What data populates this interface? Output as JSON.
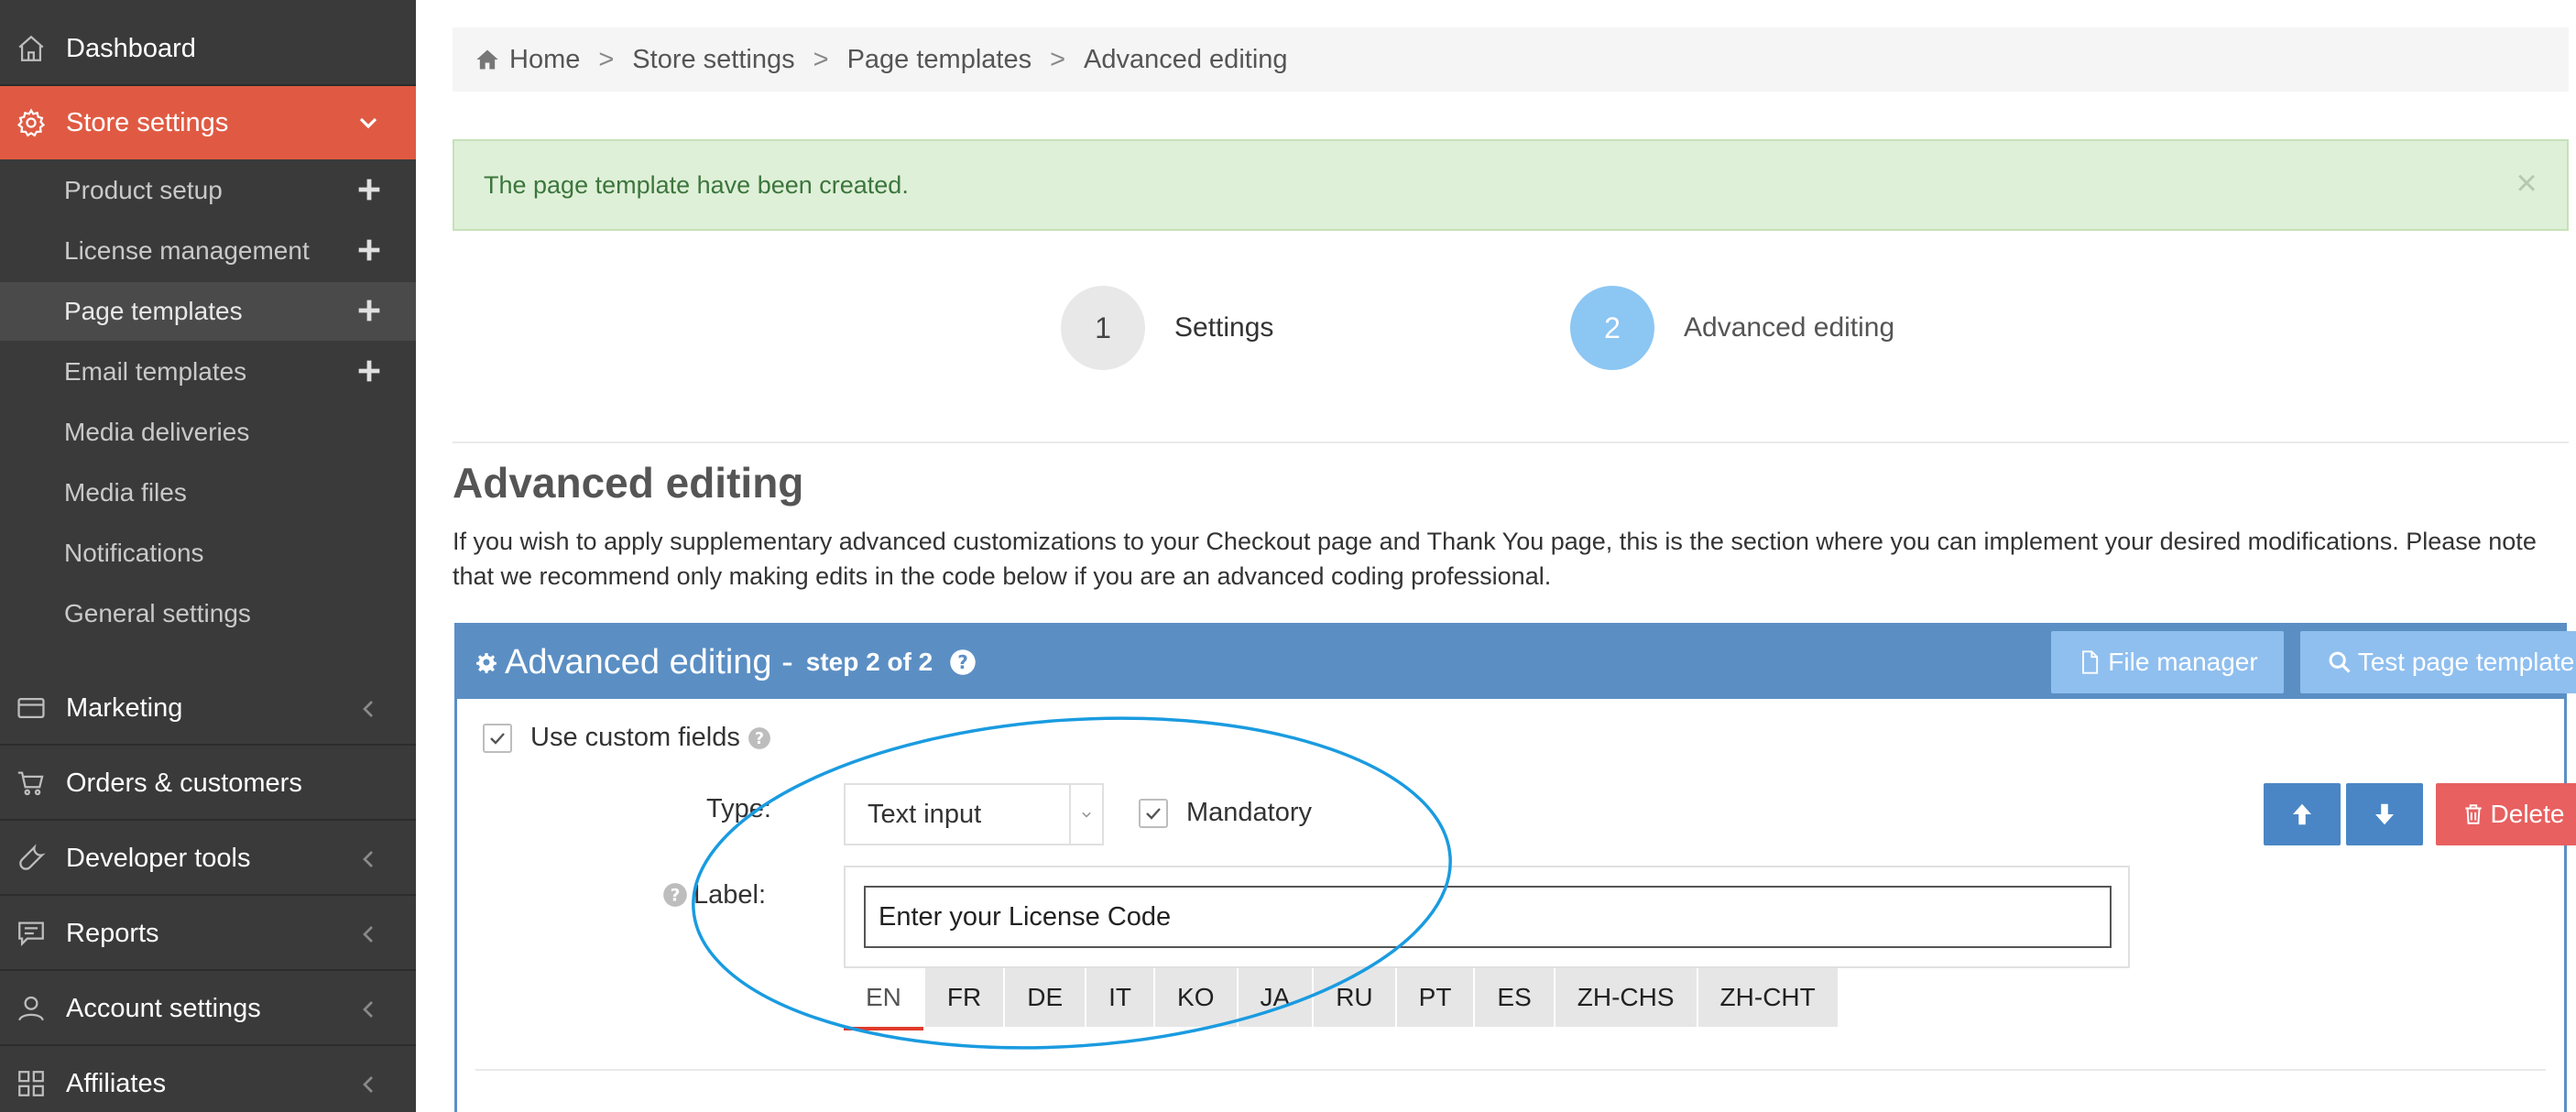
{
  "sidebar": {
    "items": [
      {
        "label": "Dashboard",
        "icon": "home-icon"
      },
      {
        "label": "Store settings",
        "icon": "gear-icon",
        "active": true
      },
      {
        "label": "Marketing",
        "icon": "card-icon"
      },
      {
        "label": "Orders & customers",
        "icon": "cart-icon"
      },
      {
        "label": "Developer tools",
        "icon": "wrench-icon"
      },
      {
        "label": "Reports",
        "icon": "chat-icon"
      },
      {
        "label": "Account settings",
        "icon": "user-icon"
      },
      {
        "label": "Affiliates",
        "icon": "grid-icon"
      }
    ],
    "submenu": [
      {
        "label": "Product setup",
        "has_plus": true
      },
      {
        "label": "License management",
        "has_plus": true
      },
      {
        "label": "Page templates",
        "has_plus": true,
        "current": true
      },
      {
        "label": "Email templates",
        "has_plus": true
      },
      {
        "label": "Media deliveries"
      },
      {
        "label": "Media files"
      },
      {
        "label": "Notifications"
      },
      {
        "label": "General settings"
      }
    ],
    "active_color": "#e05a43",
    "background": "#3a3a3a"
  },
  "breadcrumb": [
    "Home",
    "Store settings",
    "Page templates",
    "Advanced editing"
  ],
  "alert": {
    "message": "The page template have been created.",
    "close": "×"
  },
  "steps": [
    {
      "number": "1",
      "label": "Settings"
    },
    {
      "number": "2",
      "label": "Advanced editing",
      "current": true
    }
  ],
  "section": {
    "title": "Advanced editing",
    "description": "If you wish to apply supplementary advanced customizations to your Checkout page and Thank You page, this is the section where you can implement your desired modifications. Please note that we recommend only making edits in the code below if you are an advanced coding professional."
  },
  "panel": {
    "title": "Advanced editing - ",
    "step_text": "step 2 of 2",
    "file_manager": "File manager",
    "test_template": "Test page template",
    "use_custom_fields": "Use custom fields",
    "type_label": "Type:",
    "type_value": "Text input",
    "mandatory": "Mandatory",
    "delete": "Delete",
    "label_label": "Label:",
    "label_value": "Enter your License Code",
    "languages": [
      "EN",
      "FR",
      "DE",
      "IT",
      "KO",
      "JA",
      "RU",
      "PT",
      "ES",
      "ZH-CHS",
      "ZH-CHT"
    ],
    "active_language": "EN",
    "header_color": "#5b8fc4"
  }
}
